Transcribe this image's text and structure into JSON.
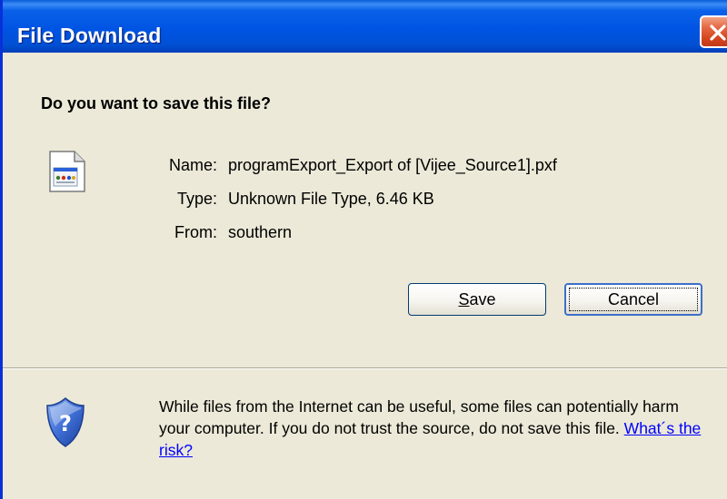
{
  "window": {
    "title": "File Download",
    "close_icon": "close-icon"
  },
  "dialog": {
    "question": "Do you want to save this file?",
    "file_icon": "document-file-icon",
    "fields": {
      "name_label": "Name:",
      "name_value": "programExport_Export of [Vijee_Source1].pxf",
      "type_label": "Type:",
      "type_value": "Unknown File Type, 6.46 KB",
      "from_label": "From:",
      "from_value": "southern"
    },
    "buttons": {
      "save_accel": "S",
      "save_rest": "ave",
      "cancel_label": "Cancel"
    }
  },
  "warning": {
    "icon": "security-shield-icon",
    "text": "While files from the Internet can be useful, some files can potentially harm your computer. If you do not trust the source, do not save this file. ",
    "link_text": "What´s the risk?"
  },
  "colors": {
    "titlebar": "#0054e3",
    "dialog_background": "#ece9d8",
    "close_button": "#d3431c",
    "link": "#0000ff"
  }
}
